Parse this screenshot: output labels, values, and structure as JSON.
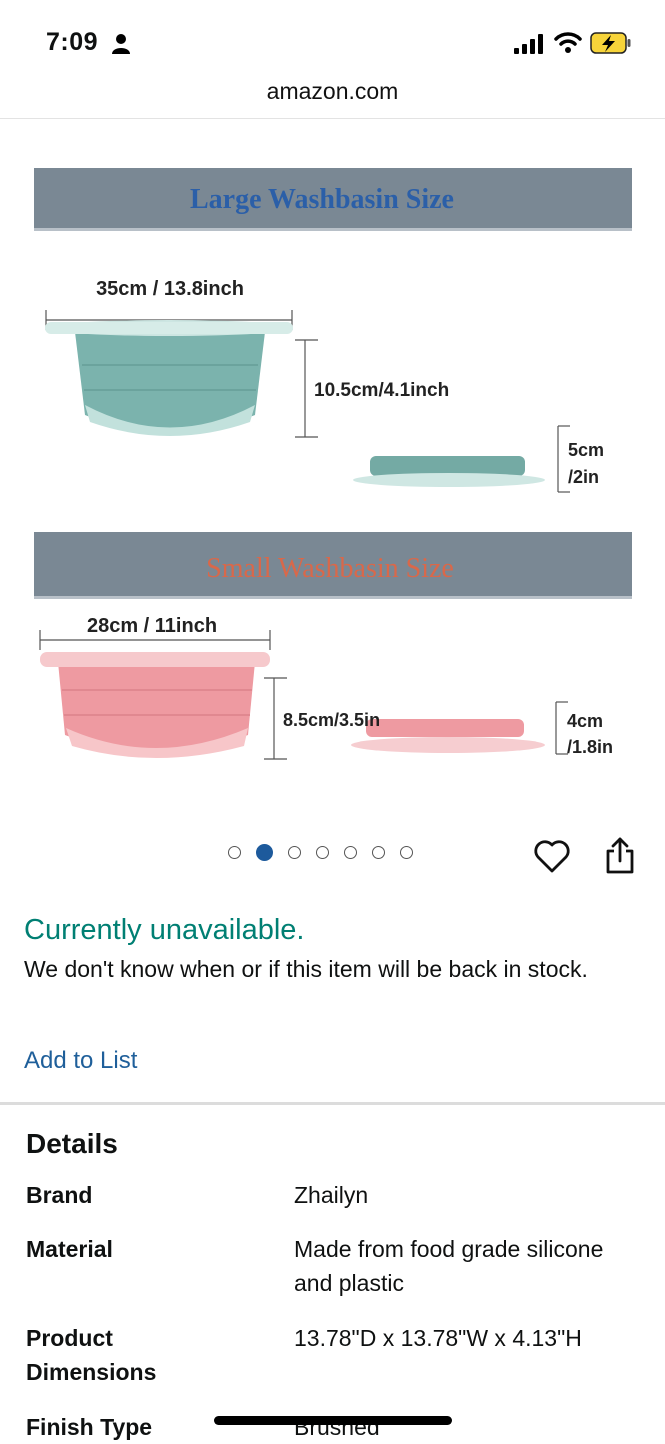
{
  "status_bar": {
    "time": "7:09"
  },
  "browser": {
    "url": "amazon.com"
  },
  "product_image": {
    "large_title": "Large Washbasin Size",
    "large_width": "35cm / 13.8inch",
    "large_height": "10.5cm/4.1inch",
    "large_folded_height_1": "5cm",
    "large_folded_height_2": "/2in",
    "small_title": "Small Washbasin Size",
    "small_width": "28cm / 11inch",
    "small_height": "8.5cm/3.5in",
    "small_folded_height_1": "4cm",
    "small_folded_height_2": "/1.8in",
    "colors": {
      "banner": "#7a8894",
      "large_title": "#2b5fa8",
      "small_title": "#d9684a",
      "teal": "#7bb3ad",
      "pink": "#f0a3a9"
    }
  },
  "carousel": {
    "total": 7,
    "active_index": 1
  },
  "availability": {
    "status": "Currently unavailable.",
    "note": "We don't know when or if this item will be back in stock."
  },
  "actions": {
    "add_to_list": "Add to List"
  },
  "details": {
    "title": "Details",
    "rows": [
      {
        "label": "Brand",
        "value": "Zhailyn"
      },
      {
        "label": "Material",
        "value": "Made from food grade silicone and plastic"
      },
      {
        "label": "Product Dimensions",
        "value": "13.78\"D x 13.78\"W x 4.13\"H"
      },
      {
        "label": "Finish Type",
        "value": "Brushed"
      }
    ]
  },
  "colors": {
    "availability": "#007f73",
    "link": "#1f5f9a",
    "dot_active": "#1d5a9c"
  }
}
